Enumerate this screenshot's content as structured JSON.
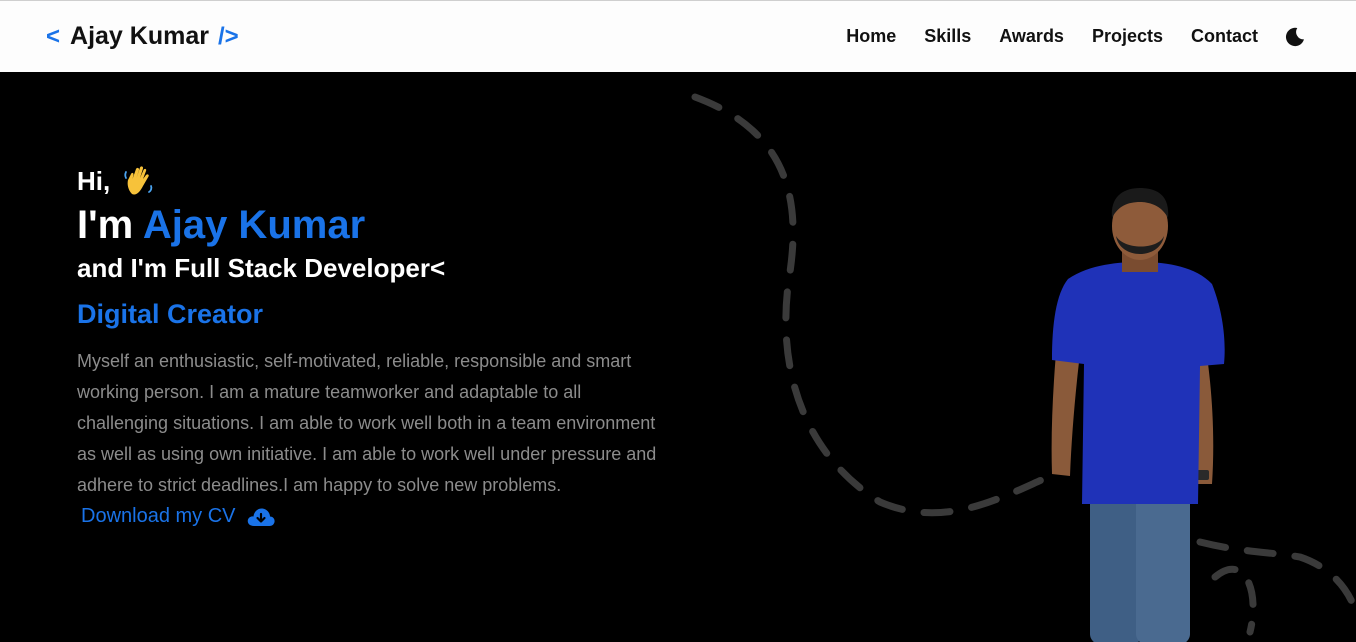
{
  "brand": {
    "open": "<",
    "name": "Ajay Kumar",
    "close": "/>"
  },
  "nav": {
    "items": [
      "Home",
      "Skills",
      "Awards",
      "Projects",
      "Contact"
    ],
    "theme_icon": "moon-icon"
  },
  "hero": {
    "greeting": "Hi,",
    "greeting_icon": "waving-hand-icon",
    "im": "I'm ",
    "name": "Ajay Kumar",
    "role": "and I'm Full Stack Developer<",
    "subtitle": "Digital Creator",
    "bio": "Myself an enthusiastic, self-motivated, reliable, responsible and smart working person. I am a mature teamworker and adaptable to all challenging situations. I am able to work well both in a team environment as well as using own initiative. I am able to work well under pressure and adhere to strict deadlines.I am happy to solve new problems. ",
    "cv_link": "Download my CV",
    "cv_icon": "cloud-download-icon"
  },
  "colors": {
    "accent": "#1a73e8",
    "background": "#000000",
    "nav_bg": "#fdfdfd",
    "body_text": "#8c8c8c"
  }
}
